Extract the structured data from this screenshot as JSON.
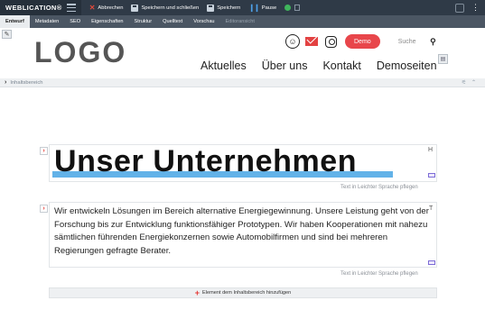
{
  "toolbar": {
    "brand": "WEBLICATION®",
    "buttons": [
      {
        "label": "Abbrechen"
      },
      {
        "label": "Speichern und schließen"
      },
      {
        "label": "Speichern"
      },
      {
        "label": "Pause"
      }
    ]
  },
  "tabs": [
    {
      "label": "Entwurf",
      "active": true
    },
    {
      "label": "Metadaten"
    },
    {
      "label": "SEO"
    },
    {
      "label": "Eigenschaften"
    },
    {
      "label": "Struktur"
    },
    {
      "label": "Quelltext"
    },
    {
      "label": "Vorschau"
    },
    {
      "label": "Editoransicht",
      "disabled": true
    }
  ],
  "site_header": {
    "logo": "LOGO",
    "demo_button": "Demo",
    "search_placeholder": "Suche",
    "nav": [
      "Aktuelles",
      "Über uns",
      "Kontakt",
      "Demoseiten"
    ]
  },
  "content_area": {
    "label": "Inhaltsbereich"
  },
  "elements": {
    "heading": "Unser Unternehmen",
    "heading_hint": "Text in Leichter Sprache pflegen",
    "paragraph": "Wir entwickeln Lösungen im Bereich alternative Energiegewinnung. Unsere Leistung geht von der Forschung bis zur Entwicklung funktionsfähiger Prototypen. Wir haben Kooperationen mit nahezu sämtlichen führenden Energiekonzernen sowie Automobilfirmen und sind bei mehreren Regierungen gefragte Berater.",
    "paragraph_hint": "Text in Leichter Sprache pflegen",
    "add_element": "Element dem Inhaltsbereich hinzufügen"
  },
  "colors": {
    "toolbar_bg": "#2f3a47",
    "tabs_bg": "#4b5663",
    "demo_button": "#e8464b",
    "heading_highlight": "#62b2e8",
    "cancel_icon": "#e14a3b"
  }
}
